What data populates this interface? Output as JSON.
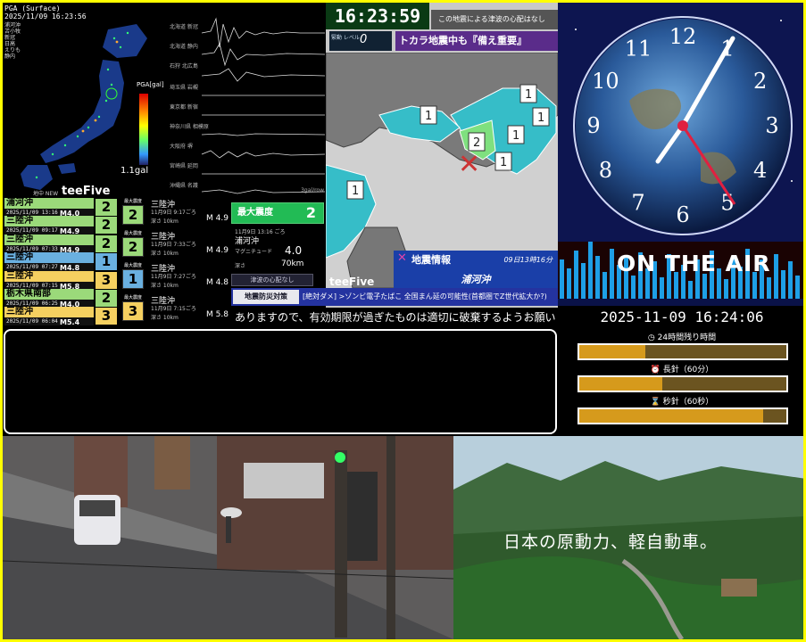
{
  "seismic": {
    "header_line1": "PGA (Surface)",
    "header_line2": "2025/11/09 16:23:56",
    "stations": [
      "浦河沖",
      "苫小牧",
      "新冠",
      "日高",
      "えりも",
      "静内"
    ],
    "pga_label": "PGA[gal]",
    "pga_value": "1.1gal",
    "brand": "teeFive",
    "footer_label": "地中 NEW",
    "wave_labels": [
      "北海道 新冠",
      "北海道 静内",
      "石狩 北広島",
      "埼玉県 岩槻",
      "東京都 新宿",
      "神奈川県 相模原",
      "大阪府 堺",
      "宮崎県 延岡",
      "沖縄県 名護"
    ],
    "wave_unit": "3gal/row",
    "quake_list": [
      {
        "loc": "浦河沖",
        "dt": "2025/11/09 13:16",
        "mag": "M4.0",
        "int": "2",
        "color": "#9bd97a"
      },
      {
        "loc": "三陸沖",
        "dt": "2025/11/09 09:17",
        "mag": "M4.9",
        "int": "2",
        "color": "#9bd97a"
      },
      {
        "loc": "三陸沖",
        "dt": "2025/11/09 07:33",
        "mag": "M4.9",
        "int": "2",
        "color": "#9bd97a"
      },
      {
        "loc": "三陸沖",
        "dt": "2025/11/09 07:27",
        "mag": "M4.8",
        "int": "1",
        "color": "#6ab0e0"
      },
      {
        "loc": "三陸沖",
        "dt": "2025/11/09 07:15",
        "mag": "M5.8",
        "int": "3",
        "color": "#f5d060"
      },
      {
        "loc": "栃木県南部",
        "dt": "2025/11/09 06:25",
        "mag": "M4.0",
        "int": "2",
        "color": "#9bd97a"
      },
      {
        "loc": "三陸沖",
        "dt": "2025/11/09 06:04",
        "mag": "M5.4",
        "int": "3",
        "color": "#f5d060"
      }
    ],
    "detail_list": [
      {
        "hdr": "最大震度",
        "loc": "三陸沖",
        "time": "11月9日 9:17ごろ",
        "depth": "深さ 10km",
        "mag": "M 4.9",
        "int": "2",
        "color": "#9bd97a"
      },
      {
        "hdr": "最大震度",
        "loc": "三陸沖",
        "time": "11月9日 7:33ごろ",
        "depth": "深さ 10km",
        "mag": "M 4.9",
        "int": "2",
        "color": "#9bd97a"
      },
      {
        "hdr": "最大震度",
        "loc": "三陸沖",
        "time": "11月9日 7:27ごろ",
        "depth": "深さ 10km",
        "mag": "M 4.8",
        "int": "1",
        "color": "#6ab0e0"
      },
      {
        "hdr": "最大震度",
        "loc": "三陸沖",
        "time": "11月9日 7:15ごろ",
        "depth": "深さ 10km",
        "mag": "M 5.8",
        "int": "3",
        "color": "#f5d060"
      }
    ],
    "latest": {
      "maxint_label": "最大震度",
      "maxint": "2",
      "time": "11月9日 13:16 ごろ",
      "loc": "浦河沖",
      "mag_label": "マグニチュード",
      "mag": "4.0",
      "depth_label": "深さ",
      "depth": "70km",
      "tsunami": "津波の心配なし"
    }
  },
  "tv": {
    "clock": "16:23:59",
    "notice": "この地震による津波の心配はなし",
    "intensity_label": "緊動 レベル",
    "intensity_value": "0",
    "headline": "トカラ地震中も『備え重要』",
    "brand": "teeFive",
    "map_intensities": [
      "1",
      "1",
      "1",
      "1",
      "2",
      "1",
      "1"
    ],
    "info_title": "地震情報",
    "info_time": "09日13時16分",
    "info_loc": "浦河沖",
    "ticker_tag": "地震防災対策",
    "ticker_text": "[絶対ダメ] >ゾンビ電子たばこ 全国まん延の可能性(首都圏でZ世代拡大か?)",
    "ticker2_text": "ありますので、有効期限が過ぎたものは適切に破棄するようお願いします"
  },
  "clock": {
    "numerals": [
      "12",
      "1",
      "2",
      "3",
      "4",
      "5",
      "6",
      "7",
      "8",
      "9",
      "10",
      "11"
    ],
    "onair": "ON THE AIR",
    "datetime": "2025-11-09 16:24:06",
    "bars": [
      {
        "label": "◷ 24時間残り時間",
        "fraction": 0.32
      },
      {
        "label": "⏰ 長針（60分）",
        "fraction": 0.4
      },
      {
        "label": "⌛ 秒針（60秒）",
        "fraction": 0.89
      }
    ]
  },
  "caption": {
    "text": ""
  },
  "ad": {
    "caption": "日本の原動力、軽自動車。"
  }
}
